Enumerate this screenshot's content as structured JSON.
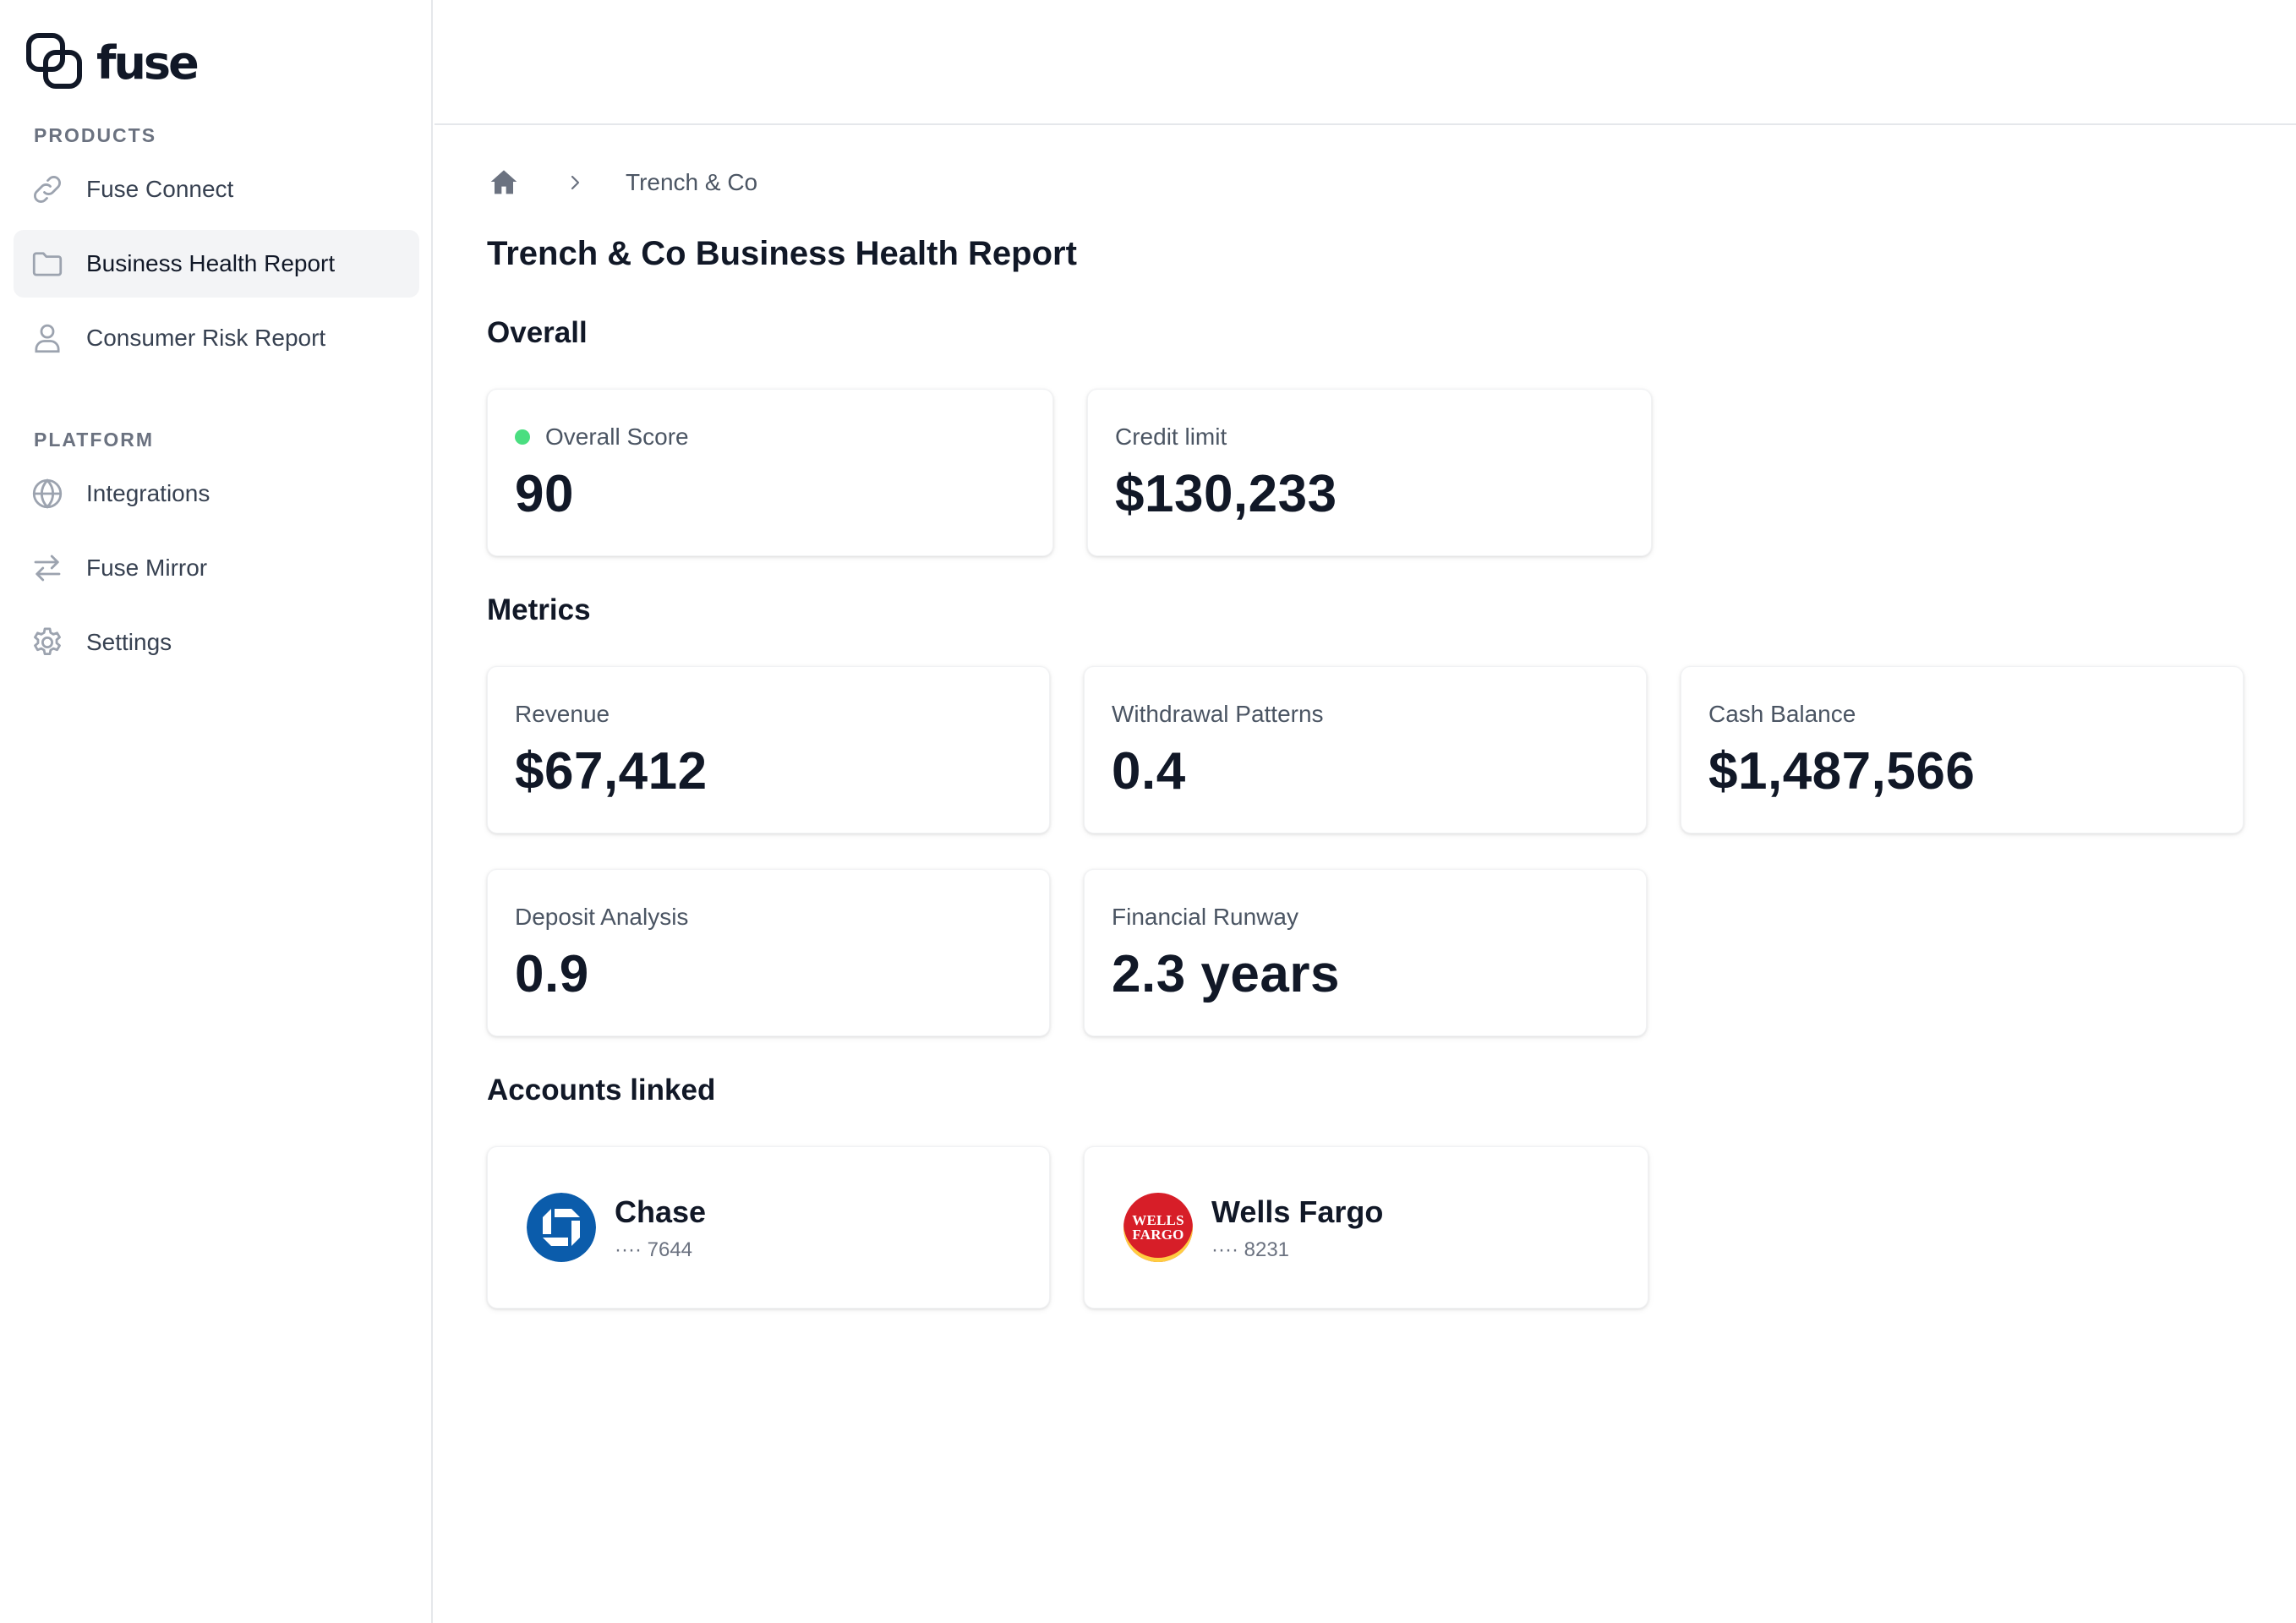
{
  "brand": {
    "name": "fuse"
  },
  "sidebar": {
    "sections": [
      {
        "label": "PRODUCTS",
        "items": [
          {
            "label": "Fuse Connect",
            "icon": "link-icon",
            "active": false
          },
          {
            "label": "Business Health Report",
            "icon": "folder-icon",
            "active": true
          },
          {
            "label": "Consumer Risk Report",
            "icon": "user-icon",
            "active": false
          }
        ]
      },
      {
        "label": "PLATFORM",
        "items": [
          {
            "label": "Integrations",
            "icon": "globe-icon",
            "active": false
          },
          {
            "label": "Fuse Mirror",
            "icon": "arrows-icon",
            "active": false
          },
          {
            "label": "Settings",
            "icon": "gear-icon",
            "active": false
          }
        ]
      }
    ]
  },
  "breadcrumb": {
    "home_icon": "home-icon",
    "separator_icon": "chevron-right-icon",
    "current": "Trench & Co"
  },
  "page": {
    "title": "Trench & Co Business Health Report",
    "overall": {
      "heading": "Overall",
      "score": {
        "label": "Overall Score",
        "value": "90",
        "status_color": "#4ade80"
      },
      "credit_limit": {
        "label": "Credit limit",
        "value": "$130,233"
      }
    },
    "metrics": {
      "heading": "Metrics",
      "items": [
        {
          "label": "Revenue",
          "value": "$67,412"
        },
        {
          "label": "Withdrawal Patterns",
          "value": "0.4"
        },
        {
          "label": "Cash Balance",
          "value": "$1,487,566"
        },
        {
          "label": "Deposit Analysis",
          "value": "0.9"
        },
        {
          "label": "Financial Runway",
          "value": "2.3 years"
        }
      ]
    },
    "accounts": {
      "heading": "Accounts linked",
      "items": [
        {
          "name": "Chase",
          "mask": "···· 7644",
          "logo": "chase-logo",
          "brand_color": "#0b5cab"
        },
        {
          "name": "Wells Fargo",
          "mask": "···· 8231",
          "logo": "wells-fargo-logo",
          "logo_text": [
            "WELLS",
            "FARGO"
          ],
          "brand_color": "#d71e28",
          "accent_color": "#ffcd41"
        }
      ]
    }
  },
  "colors": {
    "text_primary": "#111827",
    "text_secondary": "#4b5563",
    "border": "#e5e7eb",
    "active_bg": "#f3f4f6"
  }
}
